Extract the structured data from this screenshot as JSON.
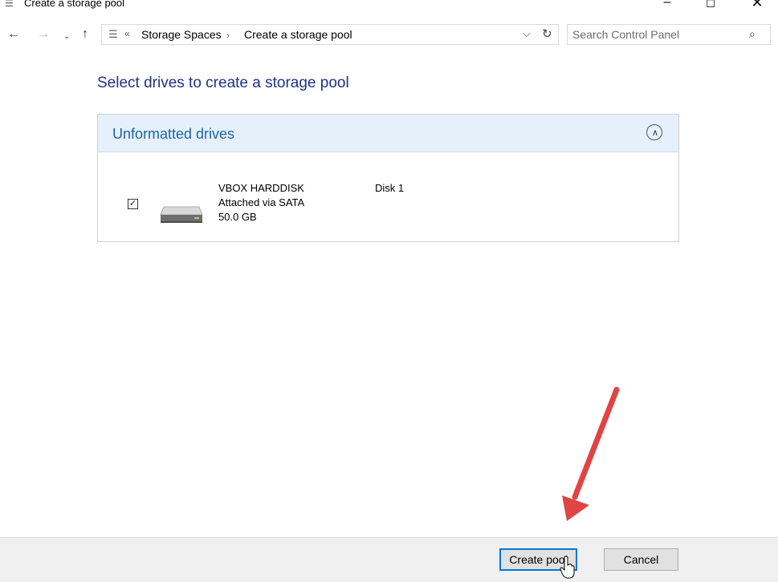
{
  "window": {
    "title": "Create a storage pool",
    "icon": "storage-spaces-icon",
    "controls": [
      "minimize",
      "maximize",
      "close"
    ]
  },
  "nav": {
    "back_icon": "arrow-left-icon",
    "forward_icon": "arrow-right-icon",
    "up_icon": "arrow-up-icon",
    "breadcrumb": [
      "Storage Spaces",
      "Create a storage pool"
    ],
    "search_placeholder": "Search Control Panel"
  },
  "main": {
    "title": "Select drives to create a storage pool",
    "section": {
      "heading": "Unformatted drives",
      "expanded": true,
      "drives": [
        {
          "checked": true,
          "icon": "hard-drive-icon",
          "name": "VBOX HARDDISK",
          "connection": "Attached via SATA",
          "size": "50.0 GB",
          "disk": "Disk 1"
        }
      ]
    }
  },
  "footer": {
    "create_label": "Create pool",
    "cancel_label": "Cancel"
  },
  "colors": {
    "title_blue": "#1e3287",
    "section_header_bg": "#e6f0fb",
    "section_heading": "#1c65a8",
    "focus_blue": "#0078d7",
    "annotation_red": "#e04444"
  }
}
